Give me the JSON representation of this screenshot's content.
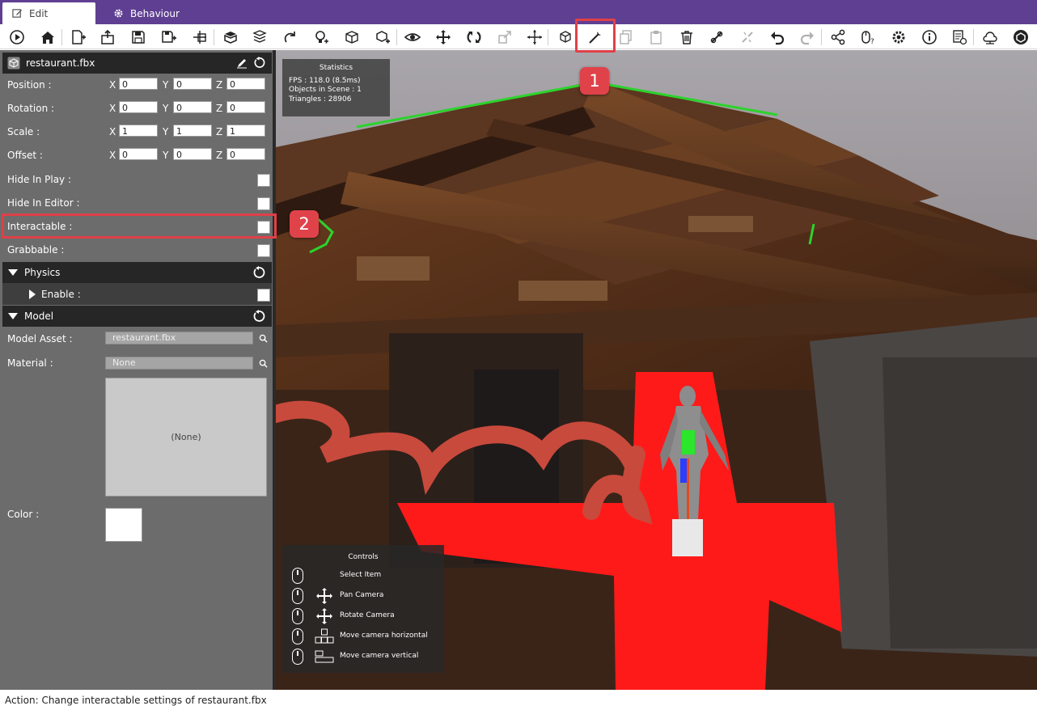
{
  "tabs": [
    {
      "label": "Edit",
      "icon": "edit-icon",
      "active": true
    },
    {
      "label": "Behaviour",
      "icon": "gear-icon",
      "active": false
    }
  ],
  "toolbar": {
    "highlighted_tool": "wrench-icon",
    "badge_1": "1",
    "icons": [
      "play-icon",
      "home-icon",
      "new-scene-icon",
      "open-scene-icon",
      "save-icon",
      "save-as-icon",
      "add-object-icon",
      "import-model-icon",
      "import-package-icon",
      "redo-scene-icon",
      "add-light-icon",
      "add-cube-icon",
      "add-box-icon",
      "view-eye-icon",
      "move-icon",
      "rotate-icon",
      "scale-icon",
      "center-move-icon",
      "cube-outline-icon",
      "wrench-icon",
      "copy-icon",
      "paste-icon",
      "delete-icon",
      "link-icon",
      "unlink-icon",
      "undo-icon",
      "redo-icon",
      "share-icon",
      "mouse-help-icon",
      "settings-gear-icon",
      "info-icon",
      "docs-icon",
      "network-icon",
      "brand-logo-icon"
    ],
    "accent_color": "#e04048"
  },
  "inspector": {
    "object_name": "restaurant.fbx",
    "position": {
      "label": "Position :",
      "x": "0",
      "y": "0",
      "z": "0"
    },
    "rotation": {
      "label": "Rotation :",
      "x": "0",
      "y": "0",
      "z": "0"
    },
    "scale": {
      "label": "Scale :",
      "x": "1",
      "y": "1",
      "z": "1"
    },
    "offset": {
      "label": "Offset :",
      "x": "0",
      "y": "0",
      "z": "0"
    },
    "axis_x": "X",
    "axis_y": "Y",
    "axis_z": "Z",
    "hide_in_play": "Hide In Play :",
    "hide_in_editor": "Hide In Editor :",
    "interactable": "Interactable :",
    "grabbable": "Grabbable :",
    "badge_2": "2",
    "physics": {
      "title": "Physics",
      "enable": "Enable :"
    },
    "model": {
      "title": "Model",
      "asset_label": "Model Asset :",
      "asset_value": "restaurant.fbx",
      "material_label": "Material :",
      "material_value": "None",
      "preview_text": "(None)",
      "color_label": "Color :",
      "color_value": "#ffffff"
    }
  },
  "viewport": {
    "statistics": {
      "title": "Statistics",
      "fps": "FPS : 118.0 (8.5ms)",
      "objects": "Objects in Scene : 1",
      "triangles": "Triangles : 28906"
    },
    "controls": {
      "title": "Controls",
      "items": [
        {
          "label": "Select Item",
          "icon": "mouse-left-icon"
        },
        {
          "label": "Pan Camera",
          "icon": "pan-arrows-icon"
        },
        {
          "label": "Rotate Camera",
          "icon": "rotate-arrows-icon"
        },
        {
          "label": "Move camera horizontal",
          "icon": "wasd-keys-icon"
        },
        {
          "label": "Move camera vertical",
          "icon": "spacebar-icon"
        }
      ]
    }
  },
  "caption": "Action: Change interactable settings of restaurant.fbx"
}
